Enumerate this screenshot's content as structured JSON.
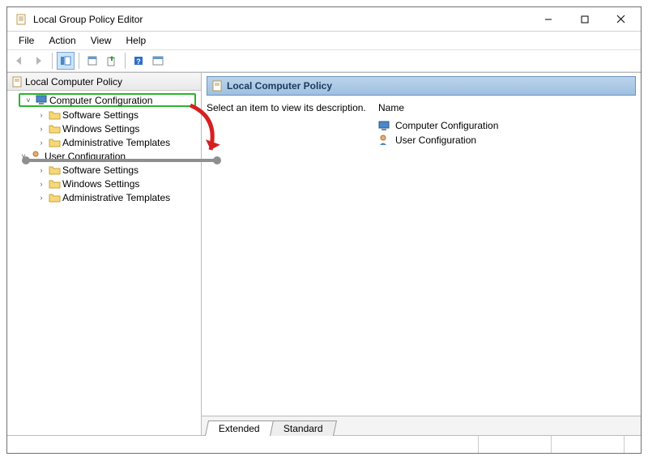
{
  "window": {
    "title": "Local Group Policy Editor"
  },
  "menu": {
    "file": "File",
    "action": "Action",
    "view": "View",
    "help": "Help"
  },
  "tree": {
    "root": "Local Computer Policy",
    "comp_cfg": "Computer Configuration",
    "comp_children": {
      "software": "Software Settings",
      "windows": "Windows Settings",
      "admin": "Administrative Templates"
    },
    "user_cfg": "User Configuration",
    "user_children": {
      "software": "Software Settings",
      "windows": "Windows Settings",
      "admin": "Administrative Templates"
    }
  },
  "right": {
    "header": "Local Computer Policy",
    "description_prompt": "Select an item to view its description.",
    "name_header": "Name",
    "items": {
      "comp": "Computer Configuration",
      "user": "User Configuration"
    }
  },
  "tabs": {
    "extended": "Extended",
    "standard": "Standard"
  }
}
